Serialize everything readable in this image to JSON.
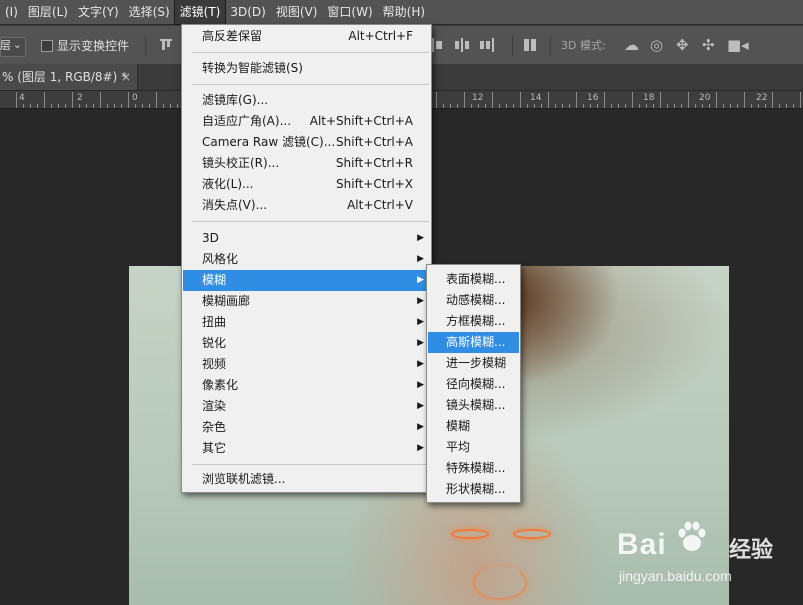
{
  "menubar": {
    "items": [
      "(I)",
      "图层(L)",
      "文字(Y)",
      "选择(S)",
      "滤镜(T)",
      "3D(D)",
      "视图(V)",
      "窗口(W)",
      "帮助(H)"
    ],
    "active_index": 4
  },
  "options_bar": {
    "layer_label": "层",
    "show_transform_label": "显示变换控件",
    "mode_3d_label": "3D 模式:"
  },
  "document_tab": {
    "title": "% (图层 1, RGB/8#) *",
    "close_glyph": "×"
  },
  "ruler": {
    "labels": [
      "4",
      "2",
      "0",
      "12",
      "14",
      "16",
      "18",
      "20",
      "22"
    ]
  },
  "filter_menu": {
    "group1": [
      {
        "label": "高反差保留",
        "shortcut": "Alt+Ctrl+F"
      }
    ],
    "group2": [
      {
        "label": "转换为智能滤镜(S)",
        "shortcut": ""
      }
    ],
    "group3": [
      {
        "label": "滤镜库(G)...",
        "shortcut": ""
      },
      {
        "label": "自适应广角(A)...",
        "shortcut": "Alt+Shift+Ctrl+A"
      },
      {
        "label": "Camera Raw 滤镜(C)...",
        "shortcut": "Shift+Ctrl+A"
      },
      {
        "label": "镜头校正(R)...",
        "shortcut": "Shift+Ctrl+R"
      },
      {
        "label": "液化(L)...",
        "shortcut": "Shift+Ctrl+X"
      },
      {
        "label": "消失点(V)...",
        "shortcut": "Alt+Ctrl+V"
      }
    ],
    "group4": [
      {
        "label": "3D"
      },
      {
        "label": "风格化"
      },
      {
        "label": "模糊",
        "highlighted": true
      },
      {
        "label": "模糊画廊"
      },
      {
        "label": "扭曲"
      },
      {
        "label": "锐化"
      },
      {
        "label": "视频"
      },
      {
        "label": "像素化"
      },
      {
        "label": "渲染"
      },
      {
        "label": "杂色"
      },
      {
        "label": "其它"
      }
    ],
    "group5": [
      {
        "label": "浏览联机滤镜..."
      }
    ]
  },
  "blur_submenu": {
    "items": [
      "表面模糊...",
      "动感模糊...",
      "方框模糊...",
      "高斯模糊...",
      "进一步模糊",
      "径向模糊...",
      "镜头模糊...",
      "模糊",
      "平均",
      "特殊模糊...",
      "形状模糊..."
    ],
    "highlighted_index": 3
  },
  "watermark": {
    "brand_left": "Bai",
    "brand_right": "经验",
    "url": "jingyan.baidu.com"
  },
  "colors": {
    "menu_highlight": "#2f8de4",
    "menu_background": "#f0f0f0",
    "toolbar": "#535353",
    "workspace": "#282828"
  }
}
